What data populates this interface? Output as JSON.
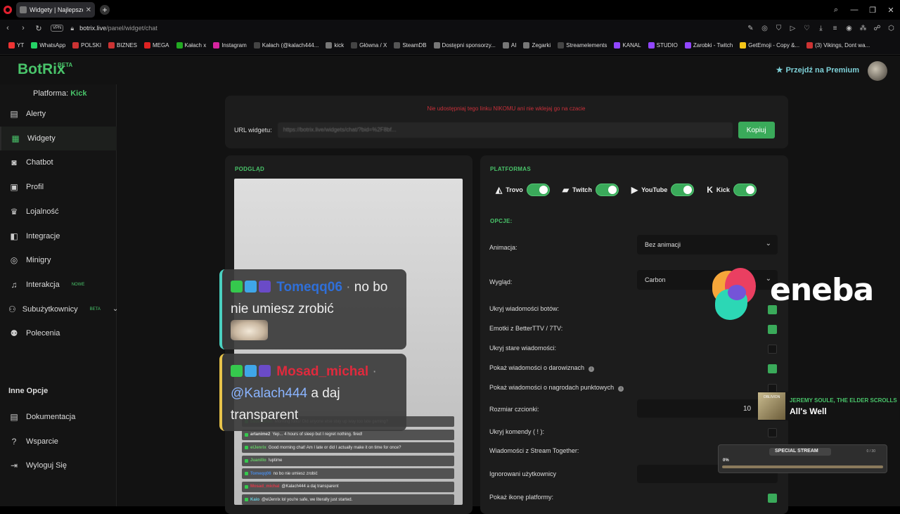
{
  "browser": {
    "tab_title": "Widgety | Najlepsze oprogr",
    "url_host": "botrix.live",
    "url_path": "/panel/widget/chat",
    "vpn_label": "VPN",
    "bookmarks": [
      "YT",
      "WhatsApp",
      "POLSKI",
      "BIZNES",
      "MEGA",
      "Kałach x",
      "Instagram",
      "Kałach (@kalach444...",
      "kick",
      "Główna / X",
      "SteamDB",
      "Dostępni sponsorzy...",
      "AI",
      "Zegarki",
      "Streamelements",
      "KANAL",
      "STUDIO",
      "Zarobki - Twitch",
      "GetEmoji - Copy &...",
      "(3) Vikings, Dont wa..."
    ]
  },
  "header": {
    "logo": "BotRix",
    "logo_badge": "BETA",
    "premium_label": "Przejdź na Premium"
  },
  "sidebar": {
    "platform_label": "Platforma:",
    "platform_value": "Kick",
    "items": [
      {
        "label": "Alerty",
        "icon": "alert-icon"
      },
      {
        "label": "Widgety",
        "icon": "widgets-icon"
      },
      {
        "label": "Chatbot",
        "icon": "robot-icon"
      },
      {
        "label": "Profil",
        "icon": "profile-icon"
      },
      {
        "label": "Lojalność",
        "icon": "trophy-icon"
      },
      {
        "label": "Integracje",
        "icon": "integration-icon"
      },
      {
        "label": "Minigry",
        "icon": "gamepad-icon"
      },
      {
        "label": "Interakcja",
        "icon": "music-icon",
        "badge": "NOWE"
      },
      {
        "label": "Subużytkownicy",
        "icon": "users-icon",
        "badge": "BETA"
      },
      {
        "label": "Polecenia",
        "icon": "referral-icon"
      }
    ],
    "section_title": "Inne Opcje",
    "other_items": [
      {
        "label": "Dokumentacja",
        "icon": "doc-icon"
      },
      {
        "label": "Wsparcie",
        "icon": "help-icon"
      },
      {
        "label": "Wyloguj Się",
        "icon": "logout-icon"
      }
    ]
  },
  "url_card": {
    "warning": "Nie udostępniaj tego linku NIKOMU ani nie wklejaj go na czacie",
    "label": "URL widgetu:",
    "value": "https://botrix.live/widgets/chat/?bid=%2F8bf...",
    "copy_button": "Kopiuj"
  },
  "preview": {
    "header": "PODGLĄD",
    "big_messages": [
      {
        "nick": "Tomeqq06",
        "nick_color": "#2f6fd8",
        "accent": "#4ad0c0",
        "text": "no bo nie umiesz zrobić",
        "sep": " · "
      },
      {
        "nick": "Mosad_michal",
        "nick_color": "#e02a3d",
        "accent": "#e7c34a",
        "mention": "@Kalach444",
        "text": "a daj transparent",
        "sep": " · "
      }
    ],
    "mini_messages": [
      {
        "nick": "badcadmin",
        "text": "Morning folks! Did anyone else stay up way too late gaming?"
      },
      {
        "nick": "artanime2",
        "text": "Yep... 4 hours of sleep but I regret nothing. fired!"
      },
      {
        "nick": "elJenrix",
        "text": "Good morning chat! Am I late or did I actually make it on time for once?"
      },
      {
        "nick": "Juanillo",
        "text": "!uptime"
      },
      {
        "nick": "Tomeqq06",
        "text": "no bo nie umiesz zrobić"
      },
      {
        "nick": "Mosad_michal",
        "text": "@Kalach444 a daj transparent"
      },
      {
        "nick": "Kaio",
        "text": "@elJenrix lol you're safe, we literally just started."
      }
    ]
  },
  "settings": {
    "platforms_header": "PLATFORMAS",
    "platforms": [
      {
        "name": "Trovo",
        "icon": "trovo-icon",
        "on": true
      },
      {
        "name": "Twitch",
        "icon": "twitch-icon",
        "on": true
      },
      {
        "name": "YouTube",
        "icon": "youtube-icon",
        "on": true
      },
      {
        "name": "Kick",
        "icon": "kick-icon",
        "on": true
      }
    ],
    "options_header": "OPCJE:",
    "animation_label": "Animacja:",
    "animation_value": "Bez animacji",
    "appearance_label": "Wygląd:",
    "appearance_value": "Carbon",
    "hide_bots": "Ukryj wiadomości botów:",
    "emotes": "Emotki z BetterTTV / 7TV:",
    "hide_old": "Ukryj stare wiadomości:",
    "show_donations": "Pokaż wiadomości o darowiznach",
    "show_rewards": "Pokaż wiadomości o nagrodach punktowych",
    "font_size_label": "Rozmiar czcionki:",
    "font_size_value": "10",
    "hide_commands": "Ukryj komendy ( ! ):",
    "stream_together": "Wiadomości z Stream Together:",
    "ignored_users": "Ignorowani użytkownicy",
    "show_platform_icon": "Pokaż ikonę platformy:"
  },
  "overlay": {
    "sponsor": "eneba",
    "now_playing_artist": "JEREMY SOULE, THE ELDER SCROLLS",
    "now_playing_song": "All's Well",
    "cover_text": "OBLIVION",
    "special_title": "SPECIAL STREAM",
    "special_count": "0 / 30",
    "special_percent": "0%"
  },
  "colors": {
    "accent": "#49c46a",
    "button": "#3aaa5a",
    "warning": "#c8303a"
  }
}
